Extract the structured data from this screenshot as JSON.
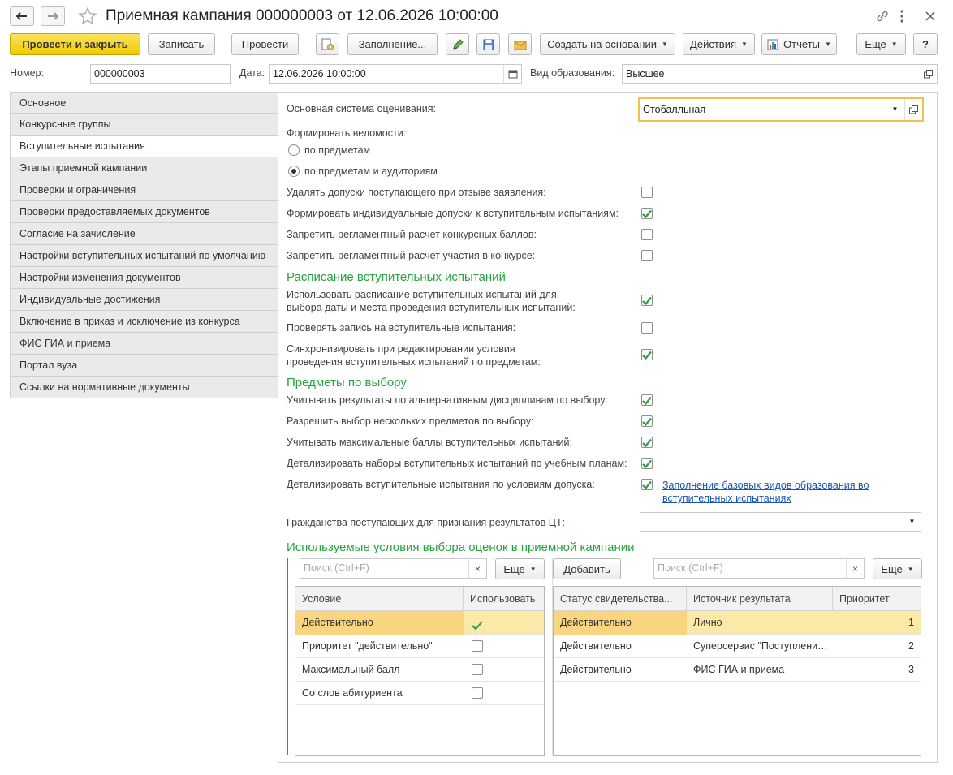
{
  "window": {
    "title": "Приемная кампания 000000003 от 12.06.2026 10:00:00"
  },
  "toolbar": {
    "post_and_close": "Провести и закрыть",
    "save": "Записать",
    "post": "Провести",
    "fill": "Заполнение...",
    "create_based": "Создать на основании",
    "actions": "Действия",
    "reports": "Отчеты",
    "more": "Еще",
    "help": "?"
  },
  "header": {
    "number_label": "Номер:",
    "number_value": "000000003",
    "date_label": "Дата:",
    "date_value": "12.06.2026 10:00:00",
    "edu_label": "Вид образования:",
    "edu_value": "Высшее"
  },
  "tabs": [
    {
      "label": "Основное"
    },
    {
      "label": "Конкурсные группы"
    },
    {
      "label": "Вступительные испытания",
      "active": true
    },
    {
      "label": "Этапы приемной кампании"
    },
    {
      "label": "Проверки и ограничения"
    },
    {
      "label": "Проверки предоставляемых документов"
    },
    {
      "label": "Согласие на зачисление"
    },
    {
      "label": "Настройки вступительных испытаний по умолчанию"
    },
    {
      "label": "Настройки изменения документов"
    },
    {
      "label": "Индивидуальные достижения"
    },
    {
      "label": "Включение в приказ и исключение из конкурса"
    },
    {
      "label": "ФИС ГИА и приема"
    },
    {
      "label": "Портал вуза"
    },
    {
      "label": "Ссылки на нормативные документы"
    }
  ],
  "form": {
    "grading_label": "Основная система оценивания:",
    "grading_value": "Стобалльная",
    "sheets_label": "Формировать ведомости:",
    "radio_subjects": "по предметам",
    "radio_subjects_rooms": "по предметам и аудиториям",
    "opt1": "Удалять допуски поступающего при отзыве заявления:",
    "opt2": "Формировать индивидуальные допуски к вступительным испытаниям:",
    "opt3": "Запретить регламентный расчет конкурсных баллов:",
    "opt4": "Запретить регламентный расчет участия в конкурсе:",
    "section_schedule": "Расписание вступительных испытаний",
    "opt5_l1": "Использовать расписание вступительных испытаний для",
    "opt5_l2": "выбора даты и места проведения вступительных испытаний:",
    "opt6": "Проверять запись на вступительные испытания:",
    "opt7_l1": "Синхронизировать при редактировании условия",
    "opt7_l2": "проведения вступительных испытаний по предметам:",
    "section_choice": "Предметы по выбору",
    "opt8": "Учитывать результаты по альтернативным дисциплинам по выбору:",
    "opt9": "Разрешить выбор нескольких предметов по выбору:",
    "opt10": "Учитывать максимальные баллы вступительных испытаний:",
    "opt11": "Детализировать наборы вступительных испытаний по учебным планам:",
    "opt12": "Детализировать вступительные испытания по условиям допуска:",
    "link_fill_l1": "Заполнение базовых видов образования во",
    "link_fill_l2": "вступительных испытаниях",
    "citizenship_label": "Гражданства поступающих для признания результатов ЦТ:",
    "citizenship_value": "",
    "section_conditions": "Используемые условия выбора оценок в приемной кампании"
  },
  "checks": {
    "opt1": false,
    "opt2": true,
    "opt3": false,
    "opt4": false,
    "opt5": true,
    "opt6": false,
    "opt7": true,
    "opt8": true,
    "opt9": true,
    "opt10": true,
    "opt11": true,
    "opt12": true
  },
  "left_table": {
    "search_placeholder": "Поиск (Ctrl+F)",
    "more": "Еще",
    "col_condition": "Условие",
    "col_use": "Использовать",
    "rows": [
      {
        "condition": "Действительно",
        "use": true
      },
      {
        "condition": "Приоритет \"действительно\"",
        "use": false
      },
      {
        "condition": "Максимальный балл",
        "use": false
      },
      {
        "condition": "Со слов абитуриента",
        "use": false
      }
    ]
  },
  "right_table": {
    "add": "Добавить",
    "search_placeholder": "Поиск (Ctrl+F)",
    "more": "Еще",
    "col_status": "Статус свидетельства...",
    "col_source": "Источник результата",
    "col_priority": "Приоритет",
    "rows": [
      {
        "status": "Действительно",
        "source": "Лично",
        "priority": "1"
      },
      {
        "status": "Действительно",
        "source": "Суперсервис \"Поступление в вуз онлайн\"",
        "priority": "2"
      },
      {
        "status": "Действительно",
        "source": "ФИС ГИА и приема",
        "priority": "3"
      }
    ]
  },
  "colors": {
    "accent_yellow": "#f2c900",
    "section_green": "#27a43f",
    "link_blue": "#1a55b3",
    "selected_row": "#fbe9a8"
  }
}
